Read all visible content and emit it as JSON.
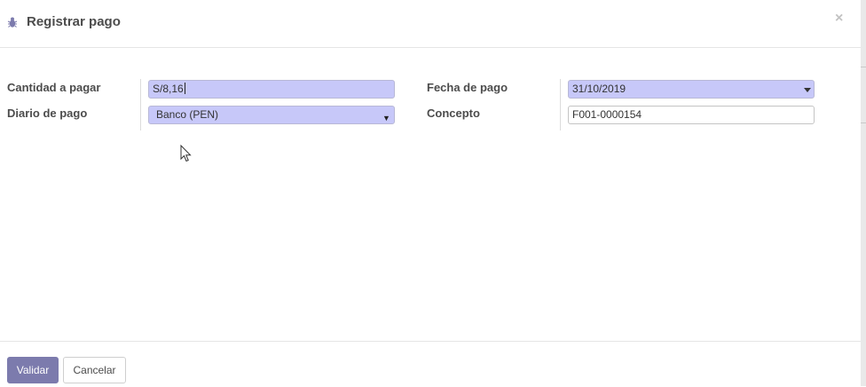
{
  "dialog": {
    "title": "Registrar pago",
    "close_label": "×"
  },
  "form": {
    "amount_label": "Cantidad a pagar",
    "amount_value": "S/8,16",
    "journal_label": "Diario de pago",
    "journal_value": "Banco (PEN)",
    "date_label": "Fecha de pago",
    "date_value": "31/10/2019",
    "memo_label": "Concepto",
    "memo_value": "F001-0000154",
    "select_caret": "▼"
  },
  "footer": {
    "validate_label": "Validar",
    "cancel_label": "Cancelar"
  },
  "colors": {
    "required_field": "#c7c8f9",
    "primary_button": "#7c7bad"
  },
  "icons": {
    "dialog": "bug-icon",
    "close": "close-icon",
    "pointer": "mouse-cursor-icon"
  }
}
